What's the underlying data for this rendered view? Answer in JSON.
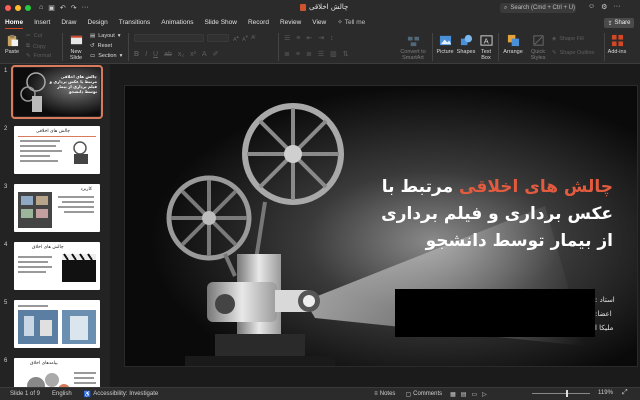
{
  "titlebar": {
    "doc_title": "چالش اخلاقی",
    "search_placeholder": "Search (Cmd + Ctrl + U)"
  },
  "tabs": [
    "Home",
    "Insert",
    "Draw",
    "Design",
    "Transitions",
    "Animations",
    "Slide Show",
    "Record",
    "Review",
    "View"
  ],
  "tell_me": "Tell me",
  "share_label": "Share",
  "ribbon": {
    "paste": "Paste",
    "cut": "Cut",
    "copy": "Copy",
    "format": "Format",
    "new_slide": "New\nSlide",
    "layout": "Layout",
    "reset": "Reset",
    "section": "Section",
    "convert_to_smartart": "Convert to\nSmartArt",
    "picture": "Picture",
    "shapes": "Shapes",
    "text_box": "Text\nBox",
    "arrange": "Arrange",
    "quick_styles": "Quick\nStyles",
    "shape_fill": "Shape Fill",
    "shape_outline": "Shape Outline",
    "add_ins": "Add-ins"
  },
  "thumbnails": [
    {
      "num": "1",
      "title": "چالش های اخلاقی مرتبط با عکس برداری و فیلم برداری از بیمار توسط دانشجو"
    },
    {
      "num": "2",
      "title": "چالش های اخلاقی"
    },
    {
      "num": "3",
      "title": "کاربرد"
    },
    {
      "num": "4",
      "title": "چالش های اخلاق"
    },
    {
      "num": "5",
      "title": ""
    },
    {
      "num": "6",
      "title": "پیامدهای اخلاق"
    }
  ],
  "slide": {
    "title_accent": "چالش های اخلاقی",
    "title_rest_1": " مرتبط با",
    "title_line_2": "عکس برداری و فیلم برداری",
    "title_line_3": "از بیمار توسط دانشجو",
    "side_lines": [
      "استاد :",
      "اعضا:",
      "ملیکا ا"
    ]
  },
  "statusbar": {
    "slide_of": "Slide 1 of 9",
    "language": "English",
    "accessibility": "Accessibility: Investigate",
    "notes": "Notes",
    "comments": "Comments",
    "zoom": "119%"
  },
  "colors": {
    "accent": "#d24726",
    "title_accent": "#e35b3f",
    "background": "#1e1e1e"
  }
}
